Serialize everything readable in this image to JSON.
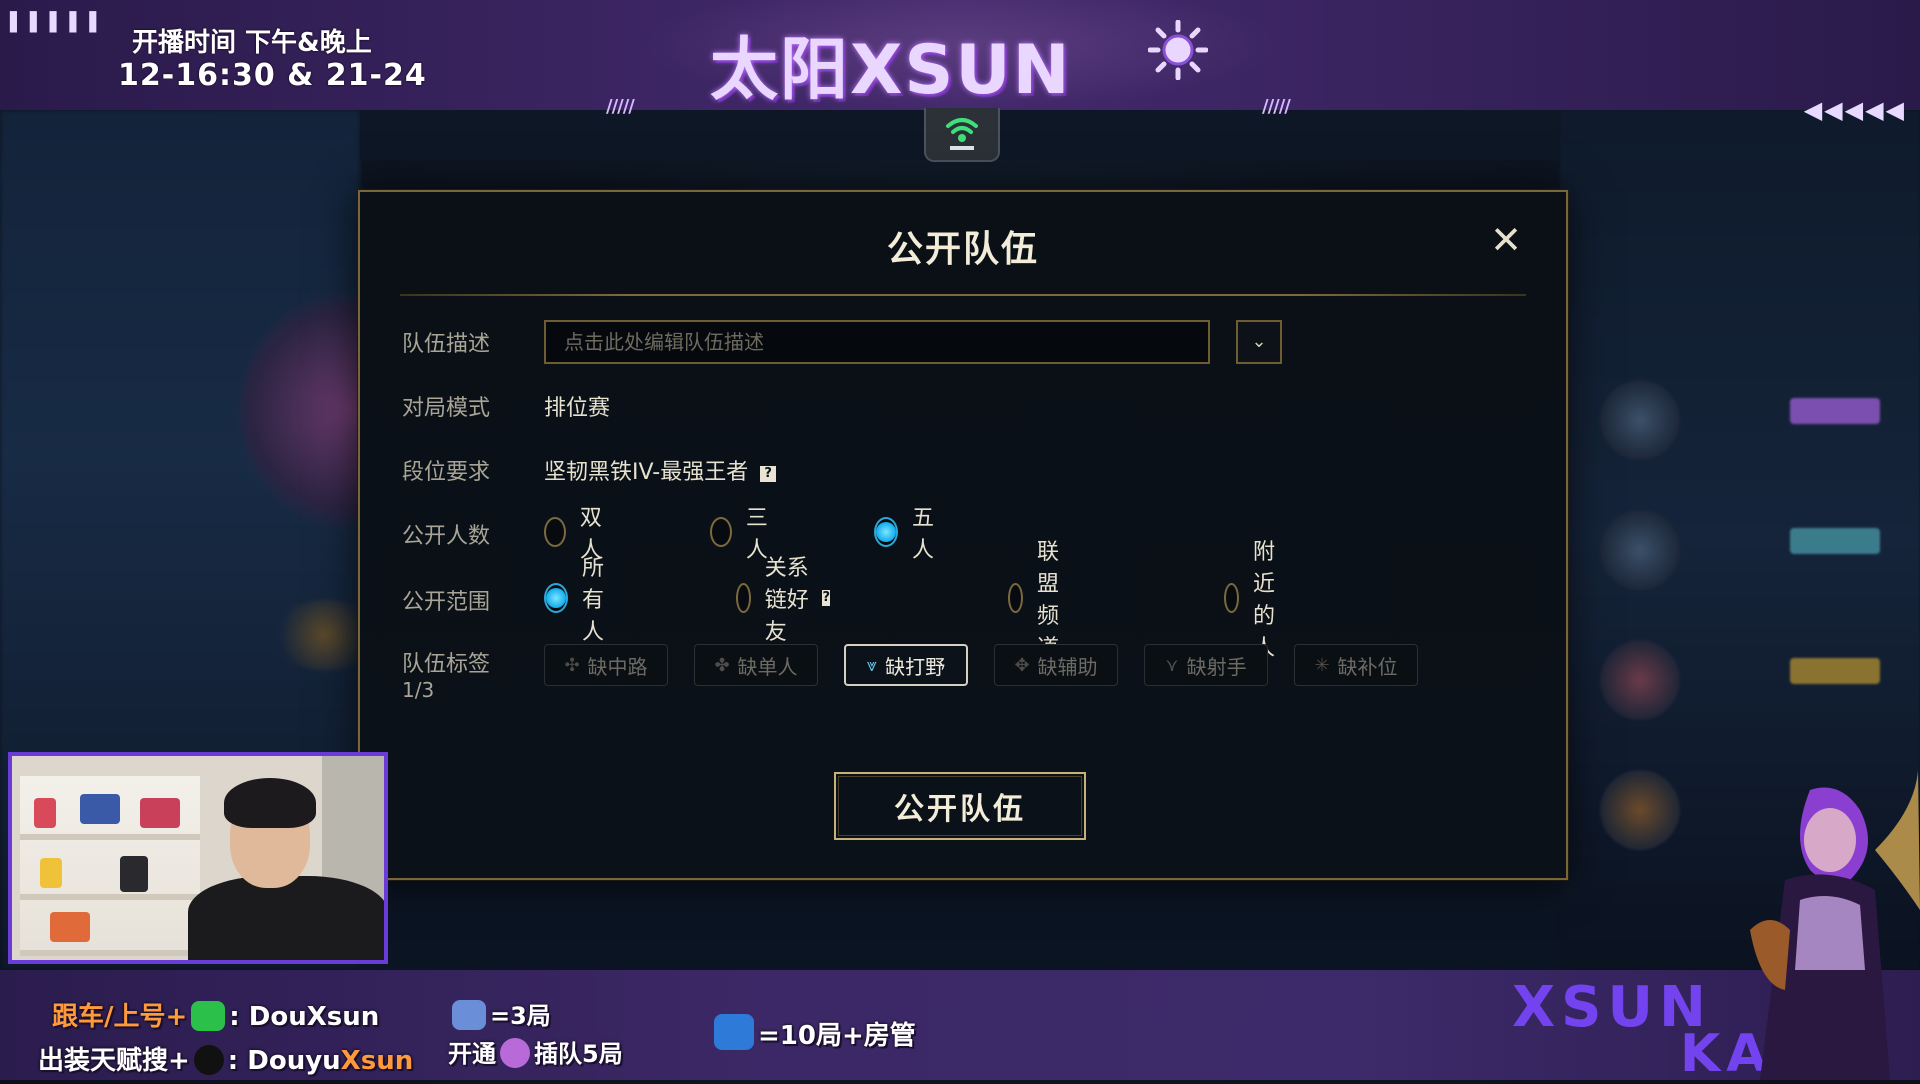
{
  "overlay": {
    "schedule_line1": "开播时间 下午&晚上",
    "schedule_line2": "12-16:30 & 21-24",
    "logo_text": "太阳XSUN",
    "dashes_left": "▌▌▌▌▌",
    "arrows_right": "◀◀◀◀◀",
    "slash": "/////"
  },
  "dialog": {
    "title": "公开队伍",
    "close_symbol": "✕",
    "fields": {
      "description_label": "队伍描述",
      "description_placeholder": "点击此处编辑队伍描述",
      "dropdown_symbol": "⌄",
      "mode_label": "对局模式",
      "mode_value": "排位赛",
      "rank_label": "段位要求",
      "rank_value": "坚韧黑铁IV-最强王者",
      "help_symbol": "?",
      "count_label": "公开人数",
      "scope_label": "公开范围",
      "tags_label": "队伍标签",
      "tags_count": "1/3"
    },
    "count_options": [
      {
        "label": "双人",
        "selected": false
      },
      {
        "label": "三人",
        "selected": false
      },
      {
        "label": "五人",
        "selected": true
      }
    ],
    "scope_options": [
      {
        "label": "所有人",
        "selected": true
      },
      {
        "label": "关系链好友",
        "selected": false
      },
      {
        "label": "联盟频道",
        "selected": false
      },
      {
        "label": "附近的人",
        "selected": false
      }
    ],
    "tags": [
      {
        "label": "缺中路",
        "icon": "mid-lane-icon",
        "glyph": "✣",
        "selected": false
      },
      {
        "label": "缺单人",
        "icon": "top-lane-icon",
        "glyph": "✤",
        "selected": false
      },
      {
        "label": "缺打野",
        "icon": "jungle-icon",
        "glyph": "⩔",
        "selected": true
      },
      {
        "label": "缺辅助",
        "icon": "support-icon",
        "glyph": "✥",
        "selected": false
      },
      {
        "label": "缺射手",
        "icon": "adc-icon",
        "glyph": "⋎",
        "selected": false
      },
      {
        "label": "缺补位",
        "icon": "fill-icon",
        "glyph": "✳",
        "selected": false
      }
    ],
    "submit_label": "公开队伍"
  },
  "bottom": {
    "line1_prefix": "跟车/上号+",
    "line1_suffix": ": DouXsun",
    "line2_prefix": "出装天赋搜+",
    "line2_mid": ": Douyu",
    "line2_suffix": "Xsun",
    "rocket_small_text": "=3局",
    "open_prefix": "开通",
    "open_suffix": "插队5局",
    "rocket_big_text": "=10局+房管",
    "brand_line1": "XSUN",
    "brand_line2": "KAISA"
  },
  "colors": {
    "accent_gold": "#7a6638",
    "radio_on": "#1eb4f0",
    "overlay_purple": "#3c2866",
    "highlight_orange": "#ff9a3c"
  }
}
